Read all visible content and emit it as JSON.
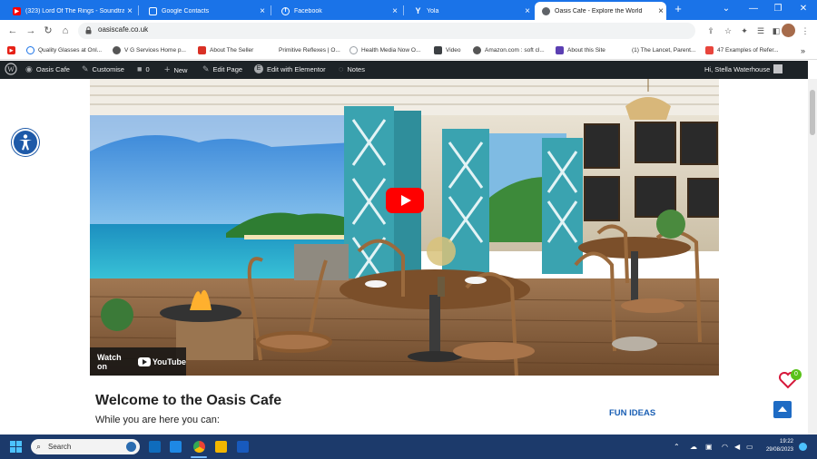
{
  "browser": {
    "tabs": [
      {
        "title": "(323) Lord Of The Rings - Soundtra",
        "icon": "youtube-icon"
      },
      {
        "title": "Google Contacts",
        "icon": "contacts-icon"
      },
      {
        "title": "Facebook",
        "icon": "facebook-icon"
      },
      {
        "title": "Yola",
        "icon": "yola-icon"
      },
      {
        "title": "Oasis Cafe - Explore the World",
        "icon": "globe-icon"
      }
    ],
    "new_tab": "+",
    "url": "oasiscafe.co.uk"
  },
  "bookmarks": [
    {
      "label": "",
      "color": "#e62117"
    },
    {
      "label": "Quality Glasses at Onl...",
      "color": "#1a73e8"
    },
    {
      "label": "V G Services Home p...",
      "color": "#555555"
    },
    {
      "label": "About The Seller",
      "color": "#d93025"
    },
    {
      "label": "Primitive Reflexes | O...",
      "color": "#ffffff"
    },
    {
      "label": "Health Media Now O...",
      "color": "#9aa0a6"
    },
    {
      "label": "Video",
      "color": "#3c4043"
    },
    {
      "label": "Amazon.com : soft cl...",
      "color": "#555555"
    },
    {
      "label": "About this Site",
      "color": "#5b3fb2"
    },
    {
      "label": "(1) The Lancet, Parent...",
      "color": "#888888"
    },
    {
      "label": "47 Examples of Refer...",
      "color": "#e8453c"
    }
  ],
  "wp_admin": {
    "site": "Oasis Cafe",
    "customise": "Customise",
    "comments": "0",
    "new": "New",
    "edit_page": "Edit Page",
    "elementor": "Edit with Elementor",
    "notes": "Notes",
    "greeting": "Hi, Stella Waterhouse"
  },
  "video": {
    "watch_on": "Watch on",
    "youtube": "YouTube"
  },
  "content": {
    "heading": "Welcome to the Oasis Cafe",
    "subtext": "While you are here you can:",
    "sidebar_heading": "FUN IDEAS",
    "favourites_count": "0"
  },
  "taskbar": {
    "search_placeholder": "Search",
    "time": "19:22",
    "date": "29/08/2023"
  },
  "colors": {
    "chrome_blue": "#1a73e8",
    "wp_bar": "#1d2327",
    "link_blue": "#1a5fb4",
    "youtube_red": "#ff0000"
  }
}
